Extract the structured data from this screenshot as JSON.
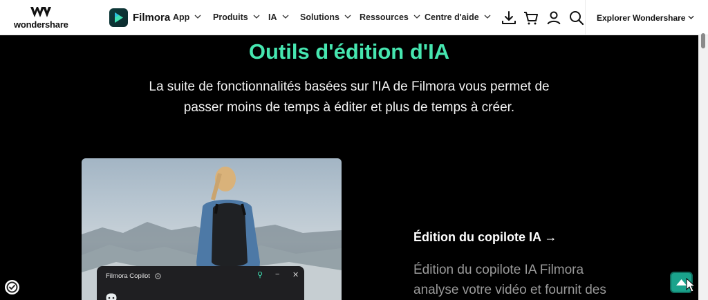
{
  "brand": {
    "company": "wondershare",
    "product": "Filmora"
  },
  "nav": {
    "items": [
      "App",
      "Produits",
      "IA",
      "Solutions",
      "Ressources",
      "Centre d'aide"
    ],
    "explorer": "Explorer Wondershare"
  },
  "header_icons": [
    "download-icon",
    "cart-icon",
    "user-icon",
    "search-icon"
  ],
  "hero": {
    "title": "Outils d'édition d'IA",
    "subtitle_line1": "La suite de fonctionnalités basées sur l'IA de Filmora vous permet de",
    "subtitle_line2": "passer moins de temps à éditer et plus de temps à créer."
  },
  "feature": {
    "title": "Édition du copilote IA",
    "arrow": "→",
    "desc_line1": "Édition du copilote IA Filmora",
    "desc_line2": "analyse votre vidéo et fournit des"
  },
  "copilot": {
    "title": "Filmora Copilot",
    "pin": "⚲",
    "minimize": "−",
    "close": "✕"
  },
  "colors": {
    "accent": "#46e6b0",
    "background": "#000000",
    "header": "#ffffff",
    "back_to_top": "#1aa38c"
  }
}
